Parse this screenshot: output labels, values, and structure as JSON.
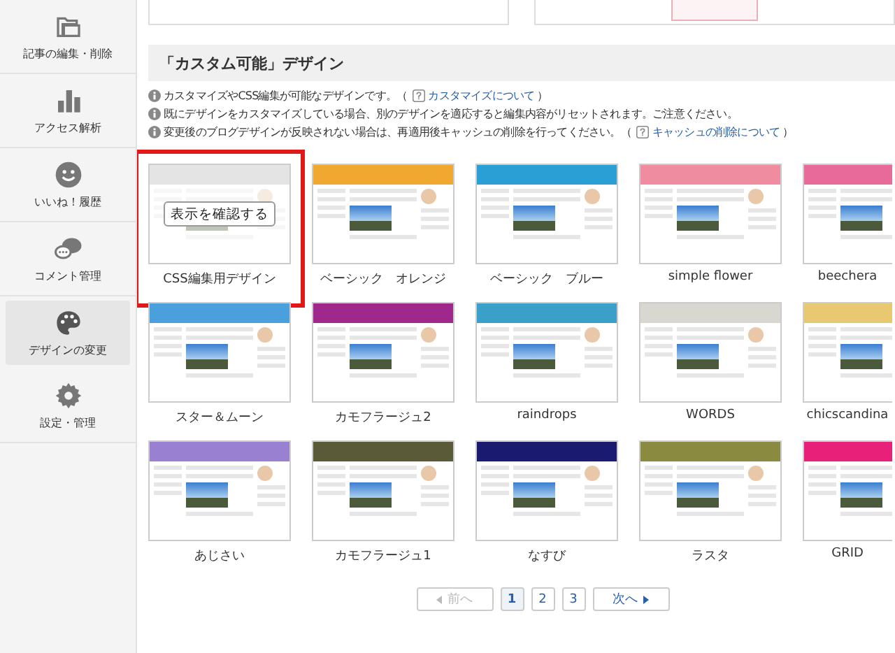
{
  "sidebar": {
    "items": [
      {
        "label": "記事の編集・削除",
        "selected": false
      },
      {
        "label": "アクセス解析",
        "selected": false
      },
      {
        "label": "いいね！履歴",
        "selected": false
      },
      {
        "label": "コメント管理",
        "selected": false
      },
      {
        "label": "デザインの変更",
        "selected": true
      },
      {
        "label": "設定・管理",
        "selected": false
      }
    ]
  },
  "section": {
    "title": "「カスタム可能」デザイン",
    "notes": [
      {
        "text": "カスタマイズやCSS編集が可能なデザインです。（",
        "link": "カスタマイズについて",
        "close": "）"
      },
      {
        "text": "既にデザインをカスタマイズしている場合、別のデザインを適応すると編集内容がリセットされます。ご注意ください。"
      },
      {
        "text": "変更後のブログデザインが反映されない場合は、再適用後キャッシュの削除を行ってください。（",
        "link": "キャッシュの削除について",
        "close": "）"
      }
    ],
    "designs": [
      {
        "name": "CSS編集用デザイン",
        "color": "#e4e4e4",
        "highlighted": true,
        "overlay_button": "表示を確認する"
      },
      {
        "name": "ベーシック　オレンジ",
        "color": "#f0a830",
        "highlighted": false
      },
      {
        "name": "ベーシック　ブルー",
        "color": "#2a9fd6",
        "highlighted": false
      },
      {
        "name": "simple flower",
        "color": "#f08ca0",
        "highlighted": false
      },
      {
        "name": "beechera",
        "color": "#e86a9a",
        "highlighted": false
      },
      {
        "name": "スター＆ムーン",
        "color": "#4aa0dc",
        "highlighted": false
      },
      {
        "name": "カモフラージュ2",
        "color": "#a0288c",
        "highlighted": false
      },
      {
        "name": "raindrops",
        "color": "#3aa0c8",
        "highlighted": false
      },
      {
        "name": "WORDS",
        "color": "#d8d8d0",
        "highlighted": false
      },
      {
        "name": "chicscandina",
        "color": "#e8c870",
        "highlighted": false
      },
      {
        "name": "あじさい",
        "color": "#9a80d0",
        "highlighted": false
      },
      {
        "name": "カモフラージュ1",
        "color": "#5a5a38",
        "highlighted": false
      },
      {
        "name": "なすび",
        "color": "#1a1a70",
        "highlighted": false
      },
      {
        "name": "ラスタ",
        "color": "#8a8a40",
        "highlighted": false
      },
      {
        "name": "GRID",
        "color": "#e8207a",
        "highlighted": false
      }
    ]
  },
  "pagination": {
    "prev": {
      "label": "前へ",
      "disabled": true
    },
    "pages": [
      {
        "label": "1",
        "selected": true
      },
      {
        "label": "2",
        "selected": false
      },
      {
        "label": "3",
        "selected": false
      }
    ],
    "next": {
      "label": "次へ",
      "disabled": false
    }
  }
}
